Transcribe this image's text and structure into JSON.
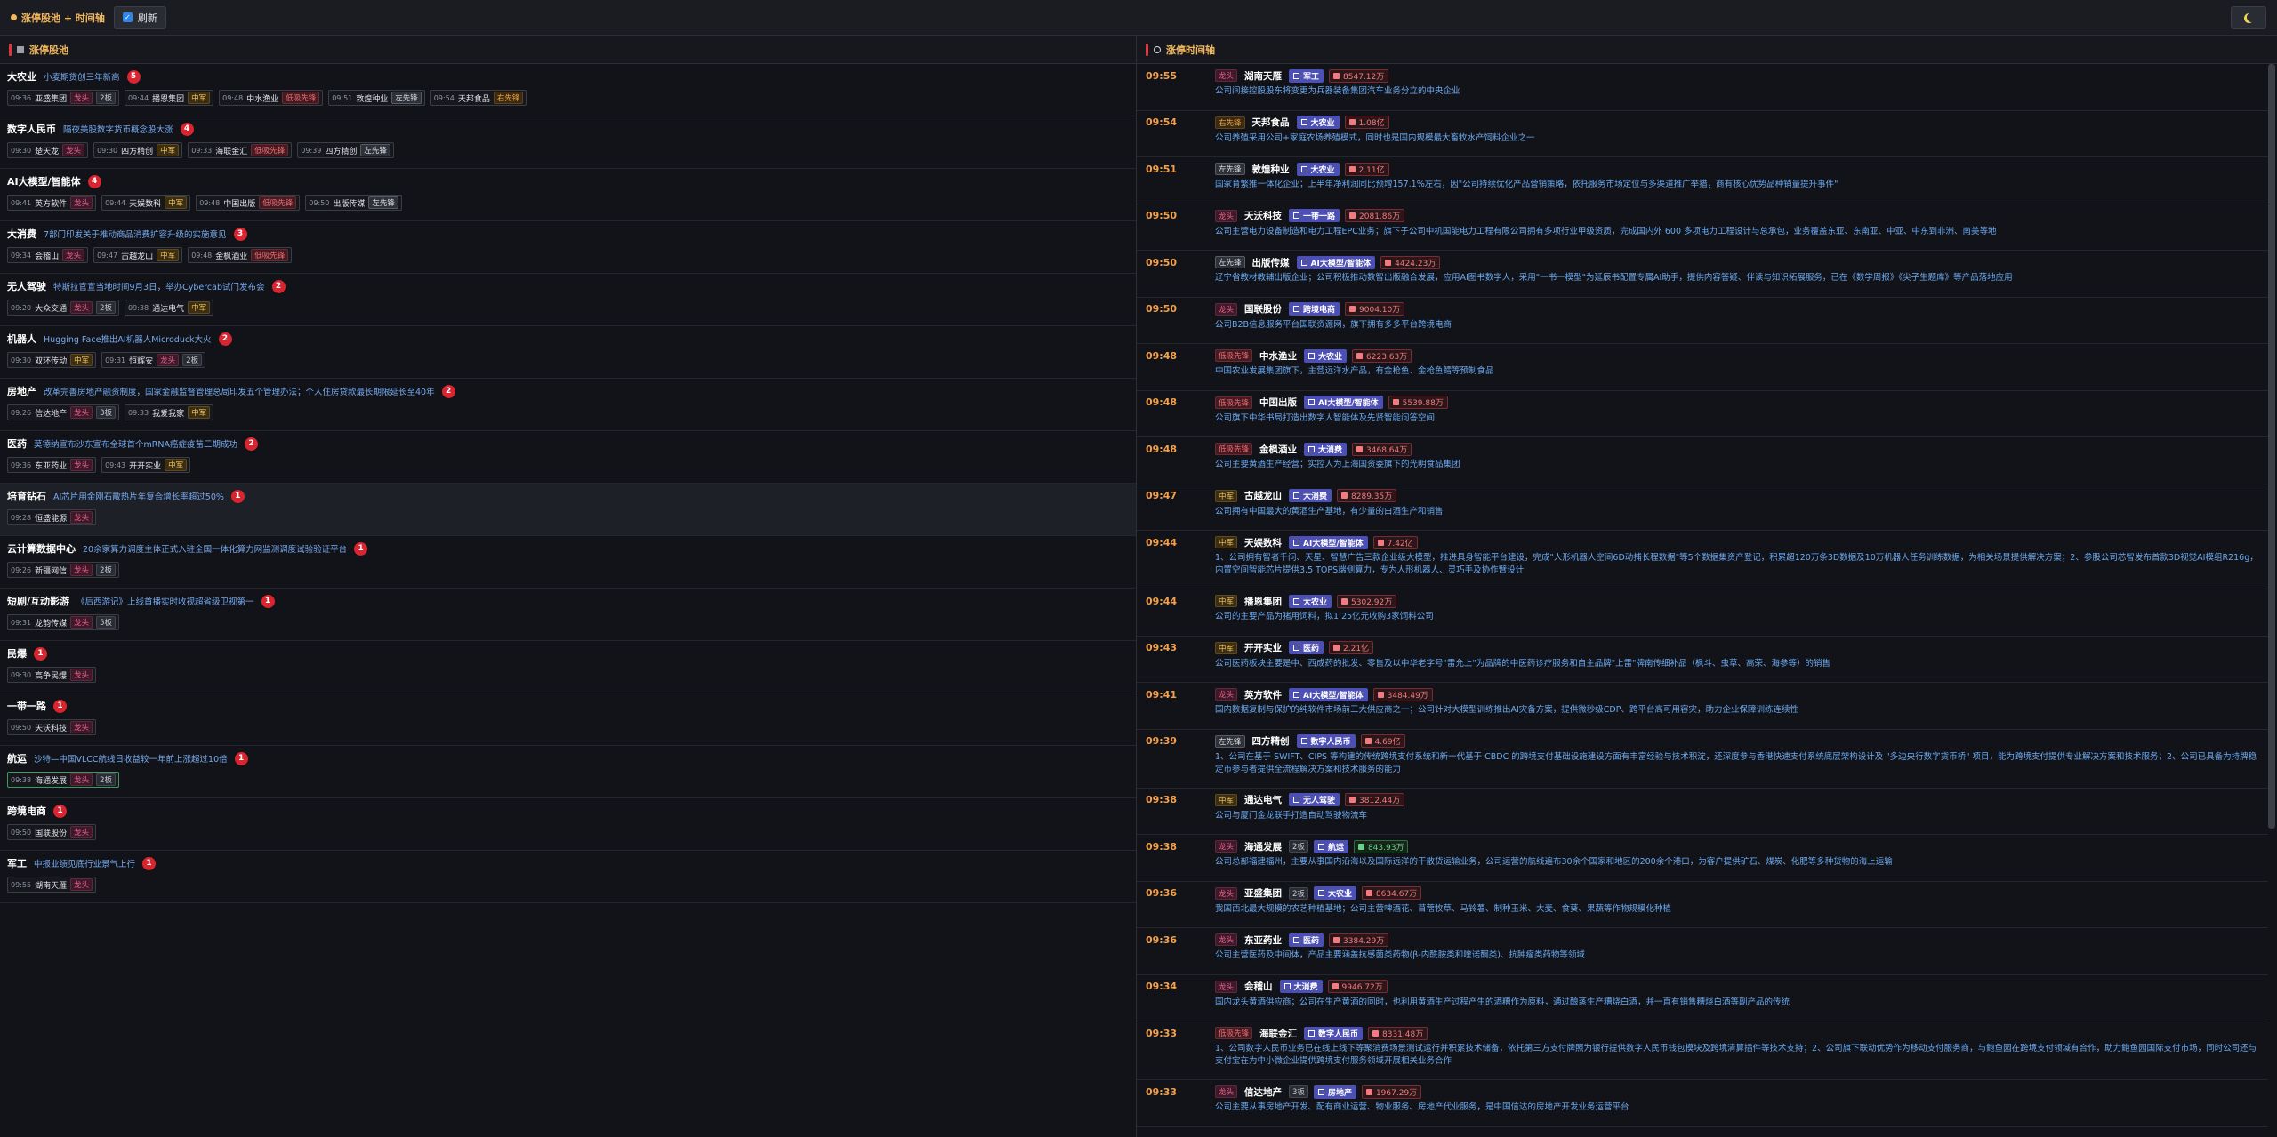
{
  "header": {
    "title": "涨停股池 + 时间轴",
    "refresh_label": "刷新",
    "theme_icon": "moon-icon"
  },
  "left": {
    "title": "涨停股池",
    "sectors": [
      {
        "name": "大农业",
        "reason": "小麦期货创三年新高",
        "count": "5",
        "stocks": [
          {
            "time": "09:36",
            "name": "亚盛集团",
            "tag": "龙头",
            "tag_type": "longtou",
            "board": "2板"
          },
          {
            "time": "09:44",
            "name": "播恩集团",
            "tag": "中军",
            "tag_type": "zhongjun",
            "board": ""
          },
          {
            "time": "09:48",
            "name": "中水渔业",
            "tag": "低吸先锋",
            "tag_type": "lingzhang",
            "board": ""
          },
          {
            "time": "09:51",
            "name": "敦煌种业",
            "tag": "左先锋",
            "tag_type": "zuoxianfeng",
            "board": ""
          },
          {
            "time": "09:54",
            "name": "天邦食品",
            "tag": "右先锋",
            "tag_type": "youxianfeng",
            "board": ""
          }
        ]
      },
      {
        "name": "数字人民币",
        "reason": "隔夜美股数字货币概念股大涨",
        "count": "4",
        "stocks": [
          {
            "time": "09:30",
            "name": "楚天龙",
            "tag": "龙头",
            "tag_type": "longtou",
            "board": ""
          },
          {
            "time": "09:30",
            "name": "四方精创",
            "tag": "中军",
            "tag_type": "zhongjun",
            "board": ""
          },
          {
            "time": "09:33",
            "name": "海联金汇",
            "tag": "低吸先锋",
            "tag_type": "lingzhang",
            "board": ""
          },
          {
            "time": "09:39",
            "name": "四方精创",
            "tag": "左先锋",
            "tag_type": "zuoxianfeng",
            "board": ""
          }
        ]
      },
      {
        "name": "AI大模型/智能体",
        "reason": "",
        "count": "4",
        "stocks": [
          {
            "time": "09:41",
            "name": "英方软件",
            "tag": "龙头",
            "tag_type": "longtou",
            "board": ""
          },
          {
            "time": "09:44",
            "name": "天娱数科",
            "tag": "中军",
            "tag_type": "zhongjun",
            "board": ""
          },
          {
            "time": "09:48",
            "name": "中国出版",
            "tag": "低吸先锋",
            "tag_type": "lingzhang",
            "board": ""
          },
          {
            "time": "09:50",
            "name": "出版传媒",
            "tag": "左先锋",
            "tag_type": "zuoxianfeng",
            "board": ""
          }
        ]
      },
      {
        "name": "大消费",
        "reason": "7部门印发关于推动商品消费扩容升级的实施意见",
        "count": "3",
        "stocks": [
          {
            "time": "09:34",
            "name": "会稽山",
            "tag": "龙头",
            "tag_type": "longtou",
            "board": ""
          },
          {
            "time": "09:47",
            "name": "古越龙山",
            "tag": "中军",
            "tag_type": "zhongjun",
            "board": ""
          },
          {
            "time": "09:48",
            "name": "金枫酒业",
            "tag": "低吸先锋",
            "tag_type": "lingzhang",
            "board": ""
          }
        ]
      },
      {
        "name": "无人驾驶",
        "reason": "特斯拉官宣当地时间9月3日，举办Cybercab试门发布会",
        "count": "2",
        "stocks": [
          {
            "time": "09:20",
            "name": "大众交通",
            "tag": "龙头",
            "tag_type": "longtou",
            "board": "2板"
          },
          {
            "time": "09:38",
            "name": "通达电气",
            "tag": "中军",
            "tag_type": "zhongjun",
            "board": ""
          }
        ]
      },
      {
        "name": "机器人",
        "reason": "Hugging Face推出AI机器人Microduck大火",
        "count": "2",
        "stocks": [
          {
            "time": "09:30",
            "name": "双环传动",
            "tag": "中军",
            "tag_type": "zhongjun",
            "board": ""
          },
          {
            "time": "09:31",
            "name": "恒辉安",
            "tag": "龙头",
            "tag_type": "longtou",
            "board": "2板"
          }
        ]
      },
      {
        "name": "房地产",
        "reason": "改革完善房地产融资制度，国家金融监督管理总局印发五个管理办法；个人住房贷款最长期限延长至40年",
        "count": "2",
        "stocks": [
          {
            "time": "09:26",
            "name": "信达地产",
            "tag": "龙头",
            "tag_type": "longtou",
            "board": "3板"
          },
          {
            "time": "09:33",
            "name": "我爱我家",
            "tag": "中军",
            "tag_type": "zhongjun",
            "board": ""
          }
        ]
      },
      {
        "name": "医药",
        "reason": "莫德纳宣布沙东宣布全球首个mRNA癌症疫苗三期成功",
        "count": "2",
        "stocks": [
          {
            "time": "09:36",
            "name": "东亚药业",
            "tag": "龙头",
            "tag_type": "longtou",
            "board": ""
          },
          {
            "time": "09:43",
            "name": "开开实业",
            "tag": "中军",
            "tag_type": "zhongjun",
            "board": ""
          }
        ]
      },
      {
        "name": "培育钻石",
        "reason": "AI芯片用金刚石散热片年复合增长率超过50%",
        "count": "1",
        "highlight": true,
        "stocks": [
          {
            "time": "09:28",
            "name": "恒盛能源",
            "tag": "龙头",
            "tag_type": "longtou",
            "board": ""
          }
        ]
      },
      {
        "name": "云计算数据中心",
        "reason": "20余家算力调度主体正式入驻全国一体化算力网监测调度试验验证平台",
        "count": "1",
        "stocks": [
          {
            "time": "09:26",
            "name": "新疆网信",
            "tag": "龙头",
            "tag_type": "longtou",
            "board": "2板"
          }
        ]
      },
      {
        "name": "短剧/互动影游",
        "reason": "《后西游记》上线首播实时收视超省级卫视第一",
        "count": "1",
        "stocks": [
          {
            "time": "09:31",
            "name": "龙韵传媒",
            "tag": "龙头",
            "tag_type": "longtou",
            "board": "5板"
          }
        ]
      },
      {
        "name": "民爆",
        "reason": "",
        "count": "1",
        "stocks": [
          {
            "time": "09:30",
            "name": "高争民爆",
            "tag": "龙头",
            "tag_type": "longtou",
            "board": ""
          }
        ]
      },
      {
        "name": "一带一路",
        "reason": "",
        "count": "1",
        "stocks": [
          {
            "time": "09:50",
            "name": "天沃科技",
            "tag": "龙头",
            "tag_type": "longtou",
            "board": ""
          }
        ]
      },
      {
        "name": "航运",
        "reason": "沙特—中国VLCC航线日收益较一年前上涨超过10倍",
        "count": "1",
        "stocks": [
          {
            "time": "09:38",
            "name": "海通发展",
            "tag": "龙头",
            "tag_type": "longtou",
            "board": "2板",
            "highlight": true
          }
        ]
      },
      {
        "name": "跨境电商",
        "reason": "",
        "count": "1",
        "stocks": [
          {
            "time": "09:50",
            "name": "国联股份",
            "tag": "龙头",
            "tag_type": "longtou",
            "board": ""
          }
        ]
      },
      {
        "name": "军工",
        "reason": "中报业绩见底行业景气上行",
        "count": "1",
        "stocks": [
          {
            "time": "09:55",
            "name": "湖南天雁",
            "tag": "龙头",
            "tag_type": "longtou",
            "board": ""
          }
        ]
      }
    ]
  },
  "right": {
    "title": "涨停时间轴",
    "items": [
      {
        "time": "09:55",
        "tag": "龙头",
        "tag_type": "longtou",
        "stock": "湖南天雁",
        "board": "",
        "sector": "军工",
        "amount": "8547.12万",
        "amount_color": "red",
        "desc": "公司间接控股股东将变更为兵器装备集团汽车业务分立的中央企业"
      },
      {
        "time": "09:54",
        "tag": "右先锋",
        "tag_type": "youxianfeng",
        "stock": "天邦食品",
        "board": "",
        "sector": "大农业",
        "amount": "1.08亿",
        "amount_color": "red",
        "desc": "公司养殖采用公司+家庭农场养殖模式，同时也是国内规模最大畜牧水产饲料企业之一"
      },
      {
        "time": "09:51",
        "tag": "左先锋",
        "tag_type": "zuoxianfeng",
        "stock": "敦煌种业",
        "board": "",
        "sector": "大农业",
        "amount": "2.11亿",
        "amount_color": "red",
        "desc": "国家育繁推一体化企业；上半年净利润同比预增157.1%左右，因\"公司持续优化产品营销策略，依托服务市场定位与多渠道推广举措，商有核心优势品种销量提升事件\""
      },
      {
        "time": "09:50",
        "tag": "龙头",
        "tag_type": "longtou",
        "stock": "天沃科技",
        "board": "",
        "sector": "一带一路",
        "amount": "2081.86万",
        "amount_color": "red",
        "desc": "公司主营电力设备制造和电力工程EPC业务；旗下子公司中机国能电力工程有限公司拥有多项行业甲级资质，完成国内外 600 多项电力工程设计与总承包，业务覆盖东亚、东南亚、中亚、中东到非洲、南美等地"
      },
      {
        "time": "09:50",
        "tag": "左先锋",
        "tag_type": "zuoxianfeng",
        "stock": "出版传媒",
        "board": "",
        "sector": "AI大模型/智能体",
        "amount": "4424.23万",
        "amount_color": "red",
        "desc": "辽宁省教材教辅出版企业；公司积极推动数智出版融合发展，应用AI图书数字人，采用\"一书一模型\"为延辰书配置专属AI助手，提供内容答疑、伴读与知识拓展服务，已在《数学周报》《尖子生题库》等产品落地应用"
      },
      {
        "time": "09:50",
        "tag": "龙头",
        "tag_type": "longtou",
        "stock": "国联股份",
        "board": "",
        "sector": "跨境电商",
        "amount": "9004.10万",
        "amount_color": "red",
        "desc": "公司B2B信息服务平台国联资源网，旗下拥有多多平台跨境电商"
      },
      {
        "time": "09:48",
        "tag": "低吸先锋",
        "tag_type": "lingzhang",
        "stock": "中水渔业",
        "board": "",
        "sector": "大农业",
        "amount": "6223.63万",
        "amount_color": "red",
        "desc": "中国农业发展集团旗下，主营远洋水产品，有金枪鱼、金枪鱼鳕等预制食品"
      },
      {
        "time": "09:48",
        "tag": "低吸先锋",
        "tag_type": "lingzhang",
        "stock": "中国出版",
        "board": "",
        "sector": "AI大模型/智能体",
        "amount": "5539.88万",
        "amount_color": "red",
        "desc": "公司旗下中华书局打造出数字人智能体及先贤智能问答空间"
      },
      {
        "time": "09:48",
        "tag": "低吸先锋",
        "tag_type": "lingzhang",
        "stock": "金枫酒业",
        "board": "",
        "sector": "大消费",
        "amount": "3468.64万",
        "amount_color": "red",
        "desc": "公司主要黄酒生产经营；实控人为上海国资委旗下的光明食品集团"
      },
      {
        "time": "09:47",
        "tag": "中军",
        "tag_type": "zhongjun",
        "stock": "古越龙山",
        "board": "",
        "sector": "大消费",
        "amount": "8289.35万",
        "amount_color": "red",
        "desc": "公司拥有中国最大的黄酒生产基地，有少量的白酒生产和销售"
      },
      {
        "time": "09:44",
        "tag": "中军",
        "tag_type": "zhongjun",
        "stock": "天娱数科",
        "board": "",
        "sector": "AI大模型/智能体",
        "amount": "7.42亿",
        "amount_color": "red",
        "tall": true,
        "desc": "1、公司拥有智者千问、天星、智慧广告三款企业级大模型，推进具身智能平台建设，完成\"人形机器人空间6D动捕长程数据\"等5个数据集资产登记，积累超120万条3D数据及10万机器人任务训练数据，为相关场景提供解决方案；2、参股公司芯智发布首款3D视觉AI模组R216g，内置空间智能芯片提供3.5 TOPS端侧算力，专为人形机器人、灵巧手及协作臂设计"
      },
      {
        "time": "09:44",
        "tag": "中军",
        "tag_type": "zhongjun",
        "stock": "播恩集团",
        "board": "",
        "sector": "大农业",
        "amount": "5302.92万",
        "amount_color": "red",
        "desc": "公司的主要产品为猪用饲料，拟1.25亿元收购3家饲料公司"
      },
      {
        "time": "09:43",
        "tag": "中军",
        "tag_type": "zhongjun",
        "stock": "开开实业",
        "board": "",
        "sector": "医药",
        "amount": "2.21亿",
        "amount_color": "red",
        "desc": "公司医药板块主要是中、西成药的批发、零售及以中华老字号\"雷允上\"为品牌的中医药诊疗服务和自主品牌\"上雷\"牌南传细补品（枫斗、虫草、高荣、海参等）的销售"
      },
      {
        "time": "09:41",
        "tag": "龙头",
        "tag_type": "longtou",
        "stock": "英方软件",
        "board": "",
        "sector": "AI大模型/智能体",
        "amount": "3484.49万",
        "amount_color": "red",
        "desc": "国内数据复制与保护的纯软件市场前三大供应商之一；公司针对大模型训练推出AI灾备方案，提供微秒级CDP、跨平台高可用容灾，助力企业保障训练连续性"
      },
      {
        "time": "09:39",
        "tag": "左先锋",
        "tag_type": "zuoxianfeng",
        "stock": "四方精创",
        "board": "",
        "sector": "数字人民币",
        "amount": "4.69亿",
        "amount_color": "red",
        "tall": true,
        "desc": "1、公司在基于 SWIFT、CIPS 等构建的传统跨境支付系统和新一代基于 CBDC 的跨境支付基础设施建设方面有丰富经验与技术积淀，还深度参与香港快速支付系统底层架构设计及 \"多边央行数字货币桥\" 项目，能为跨境支付提供专业解决方案和技术服务；2、公司已具备为持牌稳定币参与者提供全流程解决方案和技术服务的能力"
      },
      {
        "time": "09:38",
        "tag": "中军",
        "tag_type": "zhongjun",
        "stock": "通达电气",
        "board": "",
        "sector": "无人驾驶",
        "amount": "3812.44万",
        "amount_color": "red",
        "desc": "公司与厦门金龙联手打造自动驾驶物流车"
      },
      {
        "time": "09:38",
        "tag": "龙头",
        "tag_type": "longtou",
        "stock": "海通发展",
        "board": "2板",
        "sector": "航运",
        "amount": "843.93万",
        "amount_color": "green",
        "desc": "公司总部福建福州，主要从事国内沿海以及国际远洋的干散货运输业务，公司运营的航线遍布30余个国家和地区的200余个港口，为客户提供矿石、煤炭、化肥等多种货物的海上运输"
      },
      {
        "time": "09:36",
        "tag": "龙头",
        "tag_type": "longtou",
        "stock": "亚盛集团",
        "board": "2板",
        "sector": "大农业",
        "amount": "8634.67万",
        "amount_color": "red",
        "desc": "我国西北最大规模的农艺种植基地；公司主营啤酒花、苜蓿牧草、马铃薯、制种玉米、大麦、食葵、果蔬等作物规模化种植"
      },
      {
        "time": "09:36",
        "tag": "龙头",
        "tag_type": "longtou",
        "stock": "东亚药业",
        "board": "",
        "sector": "医药",
        "amount": "3384.29万",
        "amount_color": "red",
        "desc": "公司主营医药及中间体，产品主要涵盖抗感菌类药物(β-内酰胺类和喹诺酮类)、抗肿瘤类药物等领域"
      },
      {
        "time": "09:34",
        "tag": "龙头",
        "tag_type": "longtou",
        "stock": "会稽山",
        "board": "",
        "sector": "大消费",
        "amount": "9946.72万",
        "amount_color": "red",
        "desc": "国内龙头黄酒供应商；公司在生产黄酒的同时，也利用黄酒生产过程产生的酒糟作为原料，通过酿蒸生产糟烧白酒，并一直有销售糟烧白酒等副产品的传统"
      },
      {
        "time": "09:33",
        "tag": "低吸先锋",
        "tag_type": "lingzhang",
        "stock": "海联金汇",
        "board": "",
        "sector": "数字人民币",
        "amount": "8331.48万",
        "amount_color": "red",
        "tall": true,
        "desc": "1、公司数字人民币业务已在线上线下等聚消费场景测试运行并积累技术储备，依托第三方支付牌照为银行提供数字人民币钱包模块及跨境清算插件等技术支持；2、公司旗下联动优势作为移动支付服务商，与鲍鱼园在跨境支付领域有合作，助力鲍鱼园国际支付市场，同时公司还与支付宝在为中小微企业提供跨境支付服务领域开展相关业务合作"
      },
      {
        "time": "09:33",
        "tag": "龙头",
        "tag_type": "longtou",
        "stock": "信达地产",
        "board": "3板",
        "sector": "房地产",
        "amount": "1967.29万",
        "amount_color": "red",
        "desc": "公司主要从事房地产开发、配有商业运营、物业服务、房地产代业服务，是中国信达的房地产开发业务运营平台"
      }
    ]
  }
}
